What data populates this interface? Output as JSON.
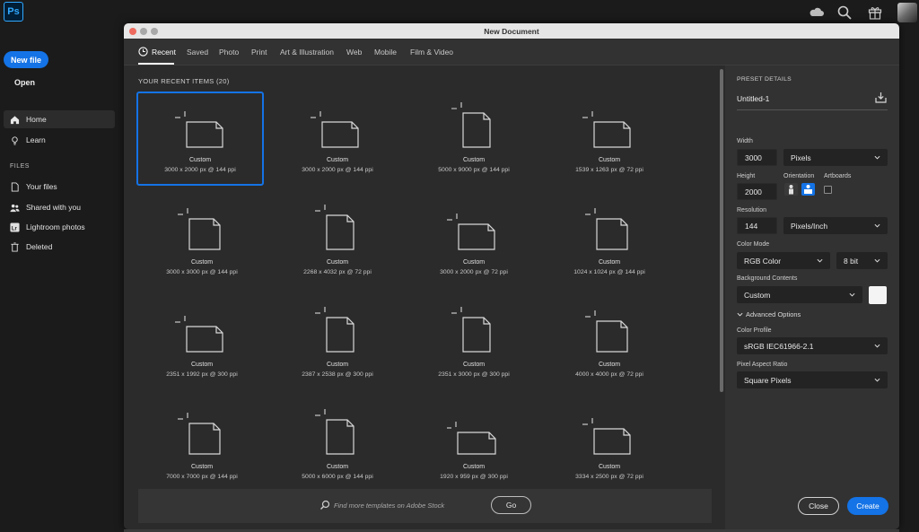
{
  "app": {
    "logo_text": "Ps",
    "theme_accent": "#1473e6"
  },
  "topbar": {
    "icons": [
      "cloud-icon",
      "search-icon",
      "gift-icon",
      "avatar"
    ]
  },
  "sidebar": {
    "new_file_label": "New file",
    "open_label": "Open",
    "items": [
      {
        "label": "Home",
        "icon": "home-icon",
        "active": true
      },
      {
        "label": "Learn",
        "icon": "lightbulb-icon",
        "active": false
      }
    ],
    "files_section_label": "FILES",
    "file_items": [
      {
        "label": "Your files",
        "icon": "file-icon"
      },
      {
        "label": "Shared with you",
        "icon": "people-icon"
      },
      {
        "label": "Lightroom photos",
        "icon": "lr-icon"
      },
      {
        "label": "Deleted",
        "icon": "trash-icon"
      }
    ]
  },
  "dialog": {
    "title": "New Document",
    "tabs": [
      {
        "label": "Recent",
        "active": true
      },
      {
        "label": "Saved"
      },
      {
        "label": "Photo"
      },
      {
        "label": "Print"
      },
      {
        "label": "Art & Illustration"
      },
      {
        "label": "Web"
      },
      {
        "label": "Mobile"
      },
      {
        "label": "Film & Video"
      }
    ],
    "recent": {
      "title": "YOUR RECENT ITEMS",
      "count": "(20)",
      "items": [
        {
          "name": "Custom",
          "size": "3000 x 2000 px @ 144 ppi",
          "selected": true,
          "orientation": "landscape"
        },
        {
          "name": "Custom",
          "size": "3000 x 2000 px @ 144 ppi",
          "orientation": "landscape"
        },
        {
          "name": "Custom",
          "size": "5000 x 9000 px @ 144 ppi",
          "orientation": "portrait"
        },
        {
          "name": "Custom",
          "size": "1539 x 1263 px @ 72 ppi",
          "orientation": "landscape"
        },
        {
          "name": "Custom",
          "size": "3000 x 3000 px @ 144 ppi",
          "orientation": "square"
        },
        {
          "name": "Custom",
          "size": "2268 x 4032 px @ 72 ppi",
          "orientation": "portrait"
        },
        {
          "name": "Custom",
          "size": "3000 x 2000 px @ 72 ppi",
          "orientation": "landscape"
        },
        {
          "name": "Custom",
          "size": "1024 x 1024 px @ 144 ppi",
          "orientation": "square"
        },
        {
          "name": "Custom",
          "size": "2351 x 1992 px @ 300 ppi",
          "orientation": "landscape"
        },
        {
          "name": "Custom",
          "size": "2387 x 2538 px @ 300 ppi",
          "orientation": "portrait"
        },
        {
          "name": "Custom",
          "size": "2351 x 3000 px @ 300 ppi",
          "orientation": "portrait"
        },
        {
          "name": "Custom",
          "size": "4000 x 4000 px @ 72 ppi",
          "orientation": "square"
        },
        {
          "name": "Custom",
          "size": "7000 x 7000 px @ 144 ppi",
          "orientation": "square"
        },
        {
          "name": "Custom",
          "size": "5000 x 6000 px @ 144 ppi",
          "orientation": "portrait"
        },
        {
          "name": "Custom",
          "size": "1920 x 959 px @ 300 ppi",
          "orientation": "wide"
        },
        {
          "name": "Custom",
          "size": "3334 x 2500 px @ 72 ppi",
          "orientation": "landscape"
        }
      ]
    },
    "search": {
      "placeholder": "Find more templates on Adobe Stock",
      "go_label": "Go"
    },
    "preset": {
      "heading": "PRESET DETAILS",
      "doc_name": "Untitled-1",
      "width_label": "Width",
      "width_value": "3000",
      "width_unit": "Pixels",
      "height_label": "Height",
      "height_value": "2000",
      "orientation_label": "Orientation",
      "artboards_label": "Artboards",
      "resolution_label": "Resolution",
      "resolution_value": "144",
      "resolution_unit": "Pixels/Inch",
      "color_mode_label": "Color Mode",
      "color_mode_value": "RGB Color",
      "bit_depth_value": "8 bit",
      "background_label": "Background Contents",
      "background_value": "Custom",
      "background_color": "#f4f4f4",
      "advanced_label": "Advanced Options",
      "color_profile_label": "Color Profile",
      "color_profile_value": "sRGB IEC61966-2.1",
      "pixel_aspect_label": "Pixel Aspect Ratio",
      "pixel_aspect_value": "Square Pixels",
      "close_label": "Close",
      "create_label": "Create"
    }
  }
}
